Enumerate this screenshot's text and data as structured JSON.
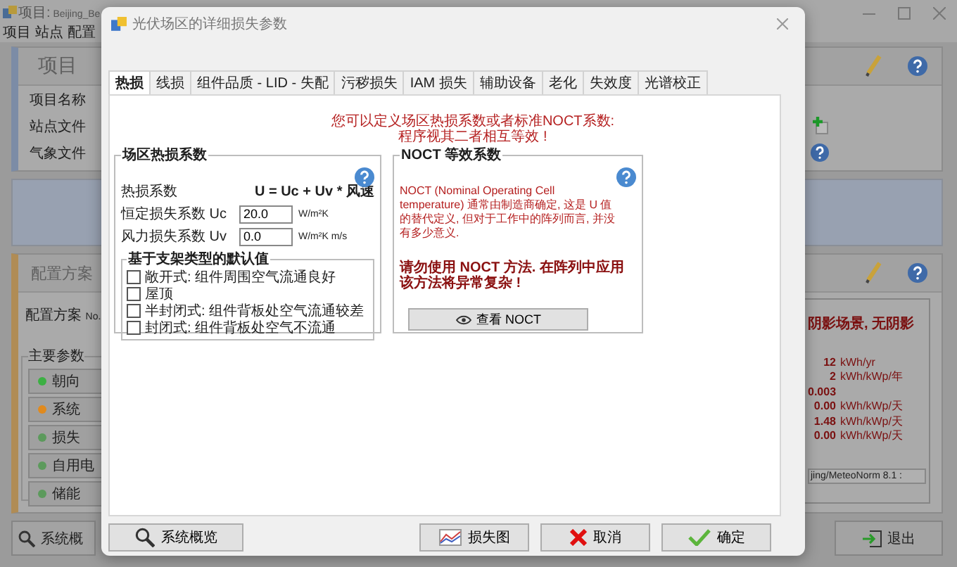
{
  "background_window": {
    "title_prefix": "项目:",
    "title_name": "Beijing_Be",
    "menu": [
      "项目",
      "站点",
      "配置"
    ],
    "project_panel": {
      "heading": "项目",
      "fields": [
        "项目名称",
        "站点文件",
        "气象文件"
      ]
    },
    "variant_panel": {
      "heading": "配置方案",
      "variant_label": "配置方案",
      "variant_no": "No.",
      "group_title": "主要参数",
      "buttons": [
        {
          "label": "朝向",
          "color": "#3cb043"
        },
        {
          "label": "系统",
          "color": "#e08a1e"
        },
        {
          "label": "损失",
          "color": "#5c9a5c"
        },
        {
          "label": "自用电",
          "color": "#5c9a5c"
        },
        {
          "label": "储能",
          "color": "#5c9a5c"
        }
      ]
    },
    "results": {
      "heading": "阴影场景, 无阴影",
      "rows": [
        {
          "value": "12",
          "unit": "kWh/yr"
        },
        {
          "value": "2",
          "unit": "kWh/kWp/年"
        },
        {
          "value": "0.003"
        },
        {
          "value": "0.00",
          "unit": "kWh/kWp/天"
        },
        {
          "value": "1.48",
          "unit": "kWh/kWp/天"
        },
        {
          "value": "0.00",
          "unit": "kWh/kWp/天"
        }
      ],
      "meteo_field": "jing/MeteoNorm 8.1 :"
    },
    "overview_button": "系统概",
    "exit_button": "退出"
  },
  "dialog": {
    "title": "光伏场区的详细损失参数",
    "tabs": [
      {
        "label": "热损",
        "selected": true
      },
      {
        "label": "线损",
        "selected": false
      },
      {
        "label": "组件品质 - LID - 失配",
        "selected": false
      },
      {
        "label": "污秽损失",
        "selected": false
      },
      {
        "label": "IAM 损失",
        "selected": false
      },
      {
        "label": "辅助设备",
        "selected": false
      },
      {
        "label": "老化",
        "selected": false
      },
      {
        "label": "失效度",
        "selected": false
      },
      {
        "label": "光谱校正",
        "selected": false
      }
    ],
    "intro": [
      "您可以定义场区热损系数或者标准NOCT系数:",
      "程序视其二者相互等效 !"
    ],
    "thermal_group": {
      "title": "场区热损系数",
      "formula_label": "热损系数",
      "formula": "U = Uc + Uv * 风速",
      "params": [
        {
          "label": "恒定损失系数 Uc",
          "value": "20.0",
          "unit": "W/m²K"
        },
        {
          "label": "风力损失系数 Uv",
          "value": "0.0",
          "unit": "W/m²K m/s"
        }
      ],
      "defaults": {
        "title": "基于支架类型的默认值",
        "options": [
          {
            "label": "敞开式: 组件周围空气流通良好",
            "checked": false
          },
          {
            "label": "屋顶",
            "checked": false
          },
          {
            "label": "半封闭式: 组件背板处空气流通较差",
            "checked": false
          },
          {
            "label": "封闭式: 组件背板处空气不流通",
            "checked": false
          }
        ]
      }
    },
    "noct_group": {
      "title": "NOCT 等效系数",
      "description": "NOCT (Nominal Operating Cell temperature) 通常由制造商确定, 这是 U 值的替代定义, 但对于工作中的阵列而言, 并没有多少意义.",
      "warning": "请勿使用 NOCT 方法. 在阵列中应用该方法将异常复杂 !",
      "button": "查看 NOCT"
    },
    "buttons": [
      {
        "label": "系统概览",
        "kind": "overview"
      },
      {
        "label": "损失图",
        "kind": "chart"
      },
      {
        "label": "取消",
        "kind": "cancel"
      },
      {
        "label": "确定",
        "kind": "ok"
      }
    ]
  }
}
